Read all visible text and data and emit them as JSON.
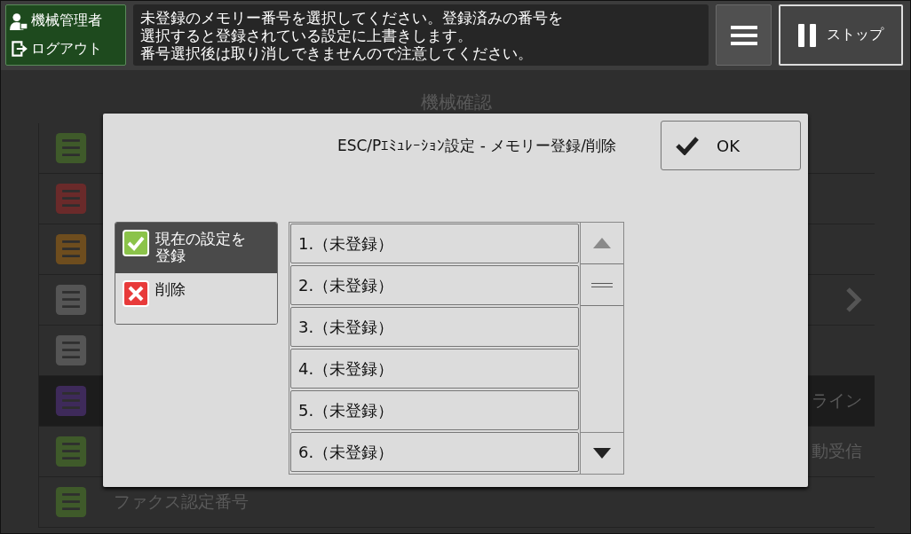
{
  "header": {
    "user": {
      "role": "機械管理者",
      "logout": "ログアウト"
    },
    "message": [
      "未登録のメモリー番号を選択してください。登録済みの番号を",
      "選択すると登録されている設定に上書きします。",
      "番号選択後は取り消しできませんので注意してください。"
    ],
    "stop_button": "ストップ"
  },
  "background": {
    "title": "機械確認",
    "rows": [
      {
        "color": "#3f5a2a",
        "selected": false,
        "chevron": false
      },
      {
        "color": "#6a2a2a",
        "selected": false,
        "chevron": false
      },
      {
        "color": "#6e4d1e",
        "selected": false,
        "chevron": false
      },
      {
        "color": "#555555",
        "selected": false,
        "chevron": true
      },
      {
        "color": "#555555",
        "selected": false,
        "chevron": false
      },
      {
        "color": "#3e2a5a",
        "selected": true,
        "chevron": false,
        "trailing": "ライン"
      },
      {
        "color": "#3f5a2a",
        "selected": false,
        "chevron": false,
        "trailing": "動受信"
      },
      {
        "color": "#3f5a2a",
        "selected": false,
        "chevron": false,
        "label": "ファクス認定番号"
      }
    ]
  },
  "dialog": {
    "title": "ESC/Pｴﾐｭﾚｰｼｮﾝ設定 - メモリー登録/削除",
    "ok_button": "OK",
    "modes": [
      {
        "kind": "register",
        "label": "現在の設定を登録",
        "selected": true
      },
      {
        "kind": "delete",
        "label": "削除",
        "selected": false
      }
    ],
    "slots": [
      "1.（未登録）",
      "2.（未登録）",
      "3.（未登録）",
      "4.（未登録）",
      "5.（未登録）",
      "6.（未登録）"
    ]
  }
}
